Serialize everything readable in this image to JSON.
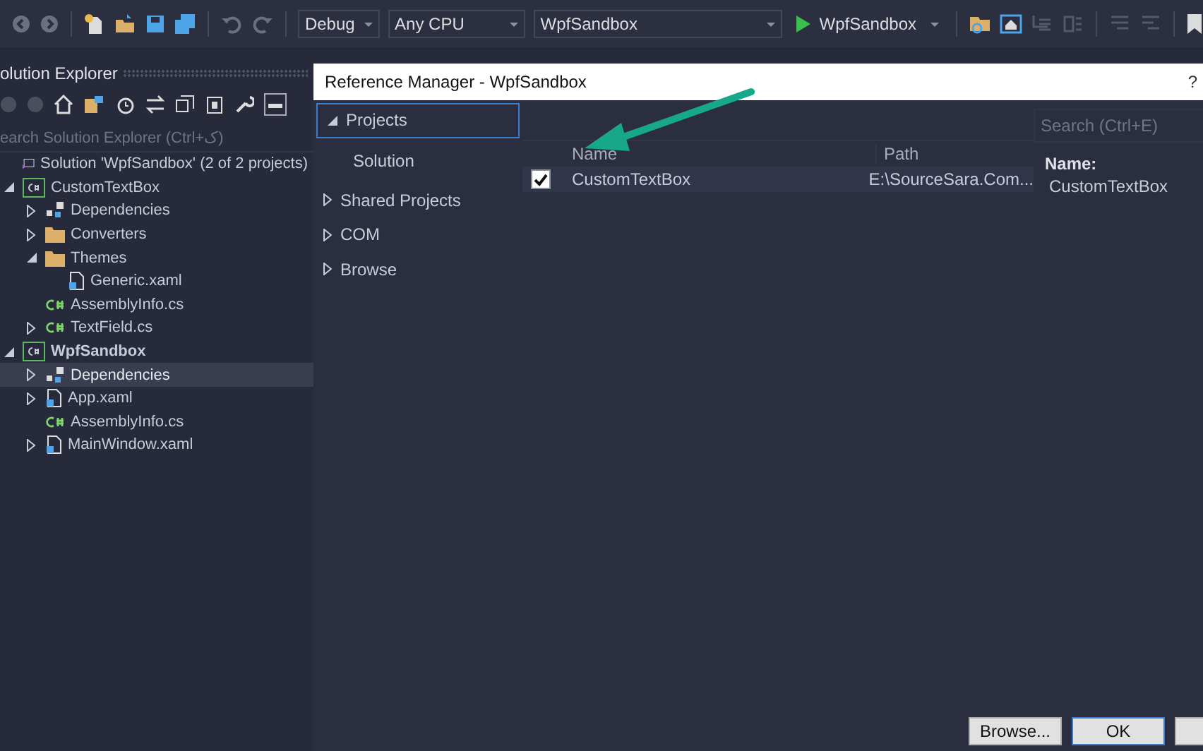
{
  "toolbar": {
    "configuration": "Debug",
    "platform": "Any CPU",
    "startup_project": "WpfSandbox",
    "run_label": "WpfSandbox"
  },
  "solution_explorer": {
    "title": "olution Explorer",
    "search": {
      "placeholder": "earch Solution Explorer (Ctrl+ک)"
    },
    "tree": [
      {
        "label": "Solution 'WpfSandbox' (2 of 2 projects)",
        "kind": "solution",
        "selected": false,
        "children": [
          {
            "label": "CustomTextBox",
            "kind": "project",
            "startup": false,
            "expanded": true,
            "selected": false,
            "children": [
              {
                "label": "Dependencies",
                "kind": "dependencies",
                "expanded": false,
                "selected": false
              },
              {
                "label": "Converters",
                "kind": "folder",
                "expanded": false,
                "selected": false
              },
              {
                "label": "Themes",
                "kind": "folder",
                "expanded": true,
                "selected": false,
                "children": [
                  {
                    "label": "Generic.xaml",
                    "kind": "xaml",
                    "selected": false
                  }
                ]
              },
              {
                "label": "AssemblyInfo.cs",
                "kind": "csharp",
                "selected": false
              },
              {
                "label": "TextField.cs",
                "kind": "csharp",
                "expanded": false,
                "selected": false
              }
            ]
          },
          {
            "label": "WpfSandbox",
            "kind": "project",
            "startup": true,
            "expanded": true,
            "selected": false,
            "children": [
              {
                "label": "Dependencies",
                "kind": "dependencies",
                "expanded": false,
                "selected": true
              },
              {
                "label": "App.xaml",
                "kind": "xaml",
                "expanded": false,
                "selected": false
              },
              {
                "label": "AssemblyInfo.cs",
                "kind": "csharp",
                "selected": false
              },
              {
                "label": "MainWindow.xaml",
                "kind": "xaml",
                "expanded": false,
                "selected": false
              }
            ]
          }
        ]
      }
    ]
  },
  "reference_manager": {
    "title": "Reference Manager - WpfSandbox",
    "help": "?",
    "nav": [
      {
        "label": "Projects",
        "expanded": true,
        "selected": true,
        "children": [
          {
            "label": "Solution",
            "selected": false
          }
        ]
      },
      {
        "label": "Shared Projects",
        "expanded": false,
        "selected": false
      },
      {
        "label": "COM",
        "expanded": false,
        "selected": false
      },
      {
        "label": "Browse",
        "expanded": false,
        "selected": false
      }
    ],
    "search": {
      "placeholder": "Search (Ctrl+E)"
    },
    "columns": [
      "Name",
      "Path"
    ],
    "rows": [
      {
        "checked": true,
        "selected": true,
        "name": "CustomTextBox",
        "path": "E:\\SourceSara.Com..."
      }
    ],
    "details": {
      "label": "Name:",
      "value": "CustomTextBox"
    },
    "buttons": [
      "Browse...",
      "OK"
    ]
  }
}
